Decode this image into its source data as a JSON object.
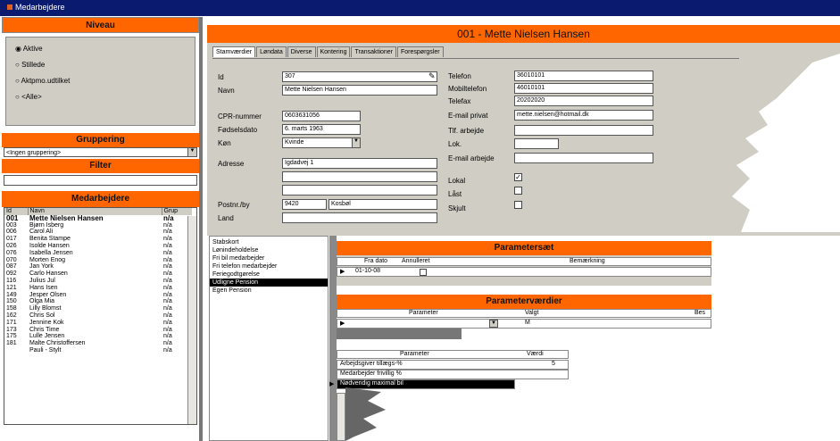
{
  "window": {
    "title": "Medarbejdere"
  },
  "left": {
    "niveau_header": "Niveau",
    "niveau_options": [
      {
        "label": "Aktive",
        "selected": true
      },
      {
        "label": "Stillede",
        "selected": false
      },
      {
        "label": "Aktpmo.udtilket",
        "selected": false
      },
      {
        "label": "<Alle>",
        "selected": false
      }
    ],
    "gruppering_header": "Gruppering",
    "gruppering_value": "<Ingen gruppering>",
    "filter_header": "Filter",
    "filter_value": "",
    "employees_header": "Medarbejdere",
    "columns": [
      "Id",
      "Navn",
      "Grup"
    ],
    "employees": [
      {
        "id": "001",
        "name": "Mette Nielsen Hansen",
        "grp": "n/a"
      },
      {
        "id": "003",
        "name": "Bjørn Isberg",
        "grp": "n/a"
      },
      {
        "id": "006",
        "name": "Carol Ali",
        "grp": "n/a"
      },
      {
        "id": "017",
        "name": "Benita Stampe",
        "grp": "n/a"
      },
      {
        "id": "026",
        "name": "Isolde Hansen",
        "grp": "n/a"
      },
      {
        "id": "076",
        "name": "Isabella Jensen",
        "grp": "n/a"
      },
      {
        "id": "070",
        "name": "Morten Enog",
        "grp": "n/a"
      },
      {
        "id": "087",
        "name": "Jan York",
        "grp": "n/a"
      },
      {
        "id": "092",
        "name": "Carlo Hansen",
        "grp": "n/a"
      },
      {
        "id": "116",
        "name": "Julius Jul",
        "grp": "n/a"
      },
      {
        "id": "121",
        "name": "Hans Isen",
        "grp": "n/a"
      },
      {
        "id": "149",
        "name": "Jesper Olsen",
        "grp": "n/a"
      },
      {
        "id": "150",
        "name": "Olga Mia",
        "grp": "n/a"
      },
      {
        "id": "158",
        "name": "Lilly Blomst",
        "grp": "n/a"
      },
      {
        "id": "162",
        "name": "Chris Sol",
        "grp": "n/a"
      },
      {
        "id": "171",
        "name": "Jennine Kok",
        "grp": "n/a"
      },
      {
        "id": "173",
        "name": "Chris Time",
        "grp": "n/a"
      },
      {
        "id": "175",
        "name": "Lulle Jensen",
        "grp": "n/a"
      },
      {
        "id": "181",
        "name": "Malte Christoffersen",
        "grp": "n/a"
      },
      {
        "id": "",
        "name": "Pauli - Stylt",
        "grp": "n/a"
      }
    ]
  },
  "header": {
    "title": "001 - Mette Nielsen Hansen"
  },
  "tabs": [
    "Stamværdier",
    "Løndata",
    "Diverse",
    "Kontering",
    "Transaktioner",
    "Forespørgsler"
  ],
  "form": {
    "id_label": "Id",
    "id_value": "307",
    "navn_label": "Navn",
    "navn_value": "Mette Nielsen Hansen",
    "cpr_label": "CPR-nummer",
    "cpr_value": "0603631056",
    "fodsel_label": "Fødselsdato",
    "fodsel_value": "6. marts 1963",
    "kon_label": "Køn",
    "kon_value": "Kvinde",
    "adresse_label": "Adresse",
    "adresse_value": "Igdadvej 1",
    "postnr_label": "Postnr./by",
    "postnr_value": "9420",
    "by_value": "Kosbøl",
    "land_label": "Land",
    "land_value": "",
    "telefon_label": "Telefon",
    "telefon_value": "36010101",
    "mobil_label": "Mobiltelefon",
    "mobil_value": "46010101",
    "telefon2_label": "Telefax",
    "telefon2_value": "20202020",
    "email_privat_label": "E-mail privat",
    "email_privat_value": "mette.nielsen@hotmail.dk",
    "tlf_arbejde_label": "Tlf. arbejde",
    "tlf_arbejde_value": "",
    "lok_label": "Lok.",
    "lok_value": "",
    "email_arbejde_label": "E-mail arbejde",
    "email_arbejde_value": "",
    "lokal_label": "Lokal",
    "lokal_checked": true,
    "laast_label": "Låst",
    "laast_checked": false,
    "skjult_label": "Skjult",
    "skjult_checked": false
  },
  "sidelist": [
    "Stabskort",
    "Lønindeholdelse",
    "Fri bil medarbejder",
    "Fri telefon medarbejder",
    "Feriegodtgørelse",
    "Udligne Pension",
    "Egen Pension"
  ],
  "sidelist_selected": 5,
  "parametersaet": {
    "header": "Parametersæt",
    "columns": [
      "Fra dato",
      "Annulleret",
      "Bemærkning"
    ],
    "rows": [
      {
        "fra": "01-10-08",
        "annulleret": false,
        "bemaerkning": ""
      }
    ]
  },
  "parametervaerdier": {
    "header": "Parameterværdier",
    "columns": [
      "Parameter",
      "Valgt",
      "Bes"
    ],
    "row_value": "",
    "row_valgt": "M",
    "sub_columns": [
      "Parameter",
      "Værdi"
    ],
    "sub_rows": [
      {
        "param": "Arbejdsgiver tillægs-%",
        "value": "5"
      },
      {
        "param": "Medarbejder frivillig %",
        "value": ""
      },
      {
        "param": "Nødvendig maximal bil",
        "value": ""
      }
    ]
  },
  "colors": {
    "accent": "#ff6600",
    "titlebar": "#0a1a6e",
    "panel": "#d0cdc4"
  }
}
